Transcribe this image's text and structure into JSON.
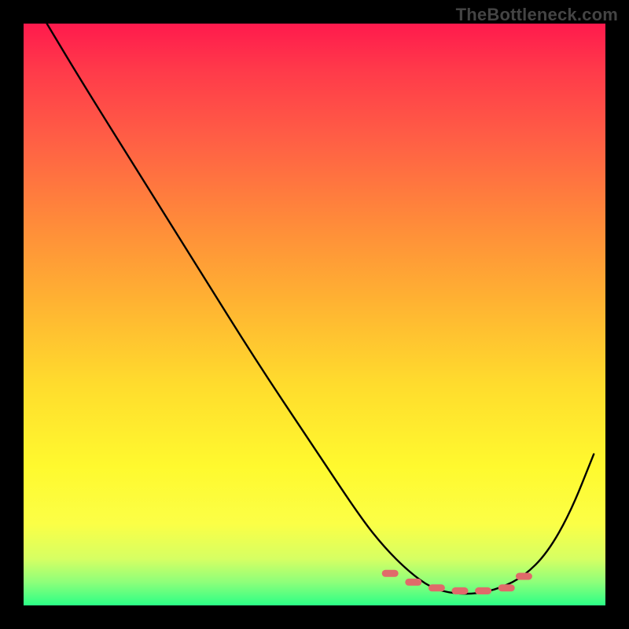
{
  "watermark": "TheBottleneck.com",
  "chart_data": {
    "type": "line",
    "title": "",
    "xlabel": "",
    "ylabel": "",
    "xlim": [
      0,
      100
    ],
    "ylim": [
      0,
      100
    ],
    "series": [
      {
        "name": "bottleneck-curve",
        "x": [
          4,
          10,
          20,
          30,
          40,
          50,
          58,
          62,
          66,
          70,
          74,
          78,
          82,
          86,
          90,
          94,
          98
        ],
        "values": [
          100,
          90,
          74,
          58,
          42,
          27,
          15,
          10,
          6,
          3,
          2,
          2,
          3,
          5,
          9,
          16,
          26
        ]
      }
    ],
    "markers": {
      "name": "optimal-range",
      "color": "#e06a6a",
      "points": [
        {
          "x": 63,
          "y": 5.5
        },
        {
          "x": 67,
          "y": 4.0
        },
        {
          "x": 71,
          "y": 3.0
        },
        {
          "x": 75,
          "y": 2.5
        },
        {
          "x": 79,
          "y": 2.5
        },
        {
          "x": 83,
          "y": 3.0
        },
        {
          "x": 86,
          "y": 5.0
        }
      ]
    },
    "gradient_stops": [
      {
        "pct": 0,
        "color": "#ff1a4d"
      },
      {
        "pct": 50,
        "color": "#ffdc2d"
      },
      {
        "pct": 100,
        "color": "#2bff86"
      }
    ]
  }
}
